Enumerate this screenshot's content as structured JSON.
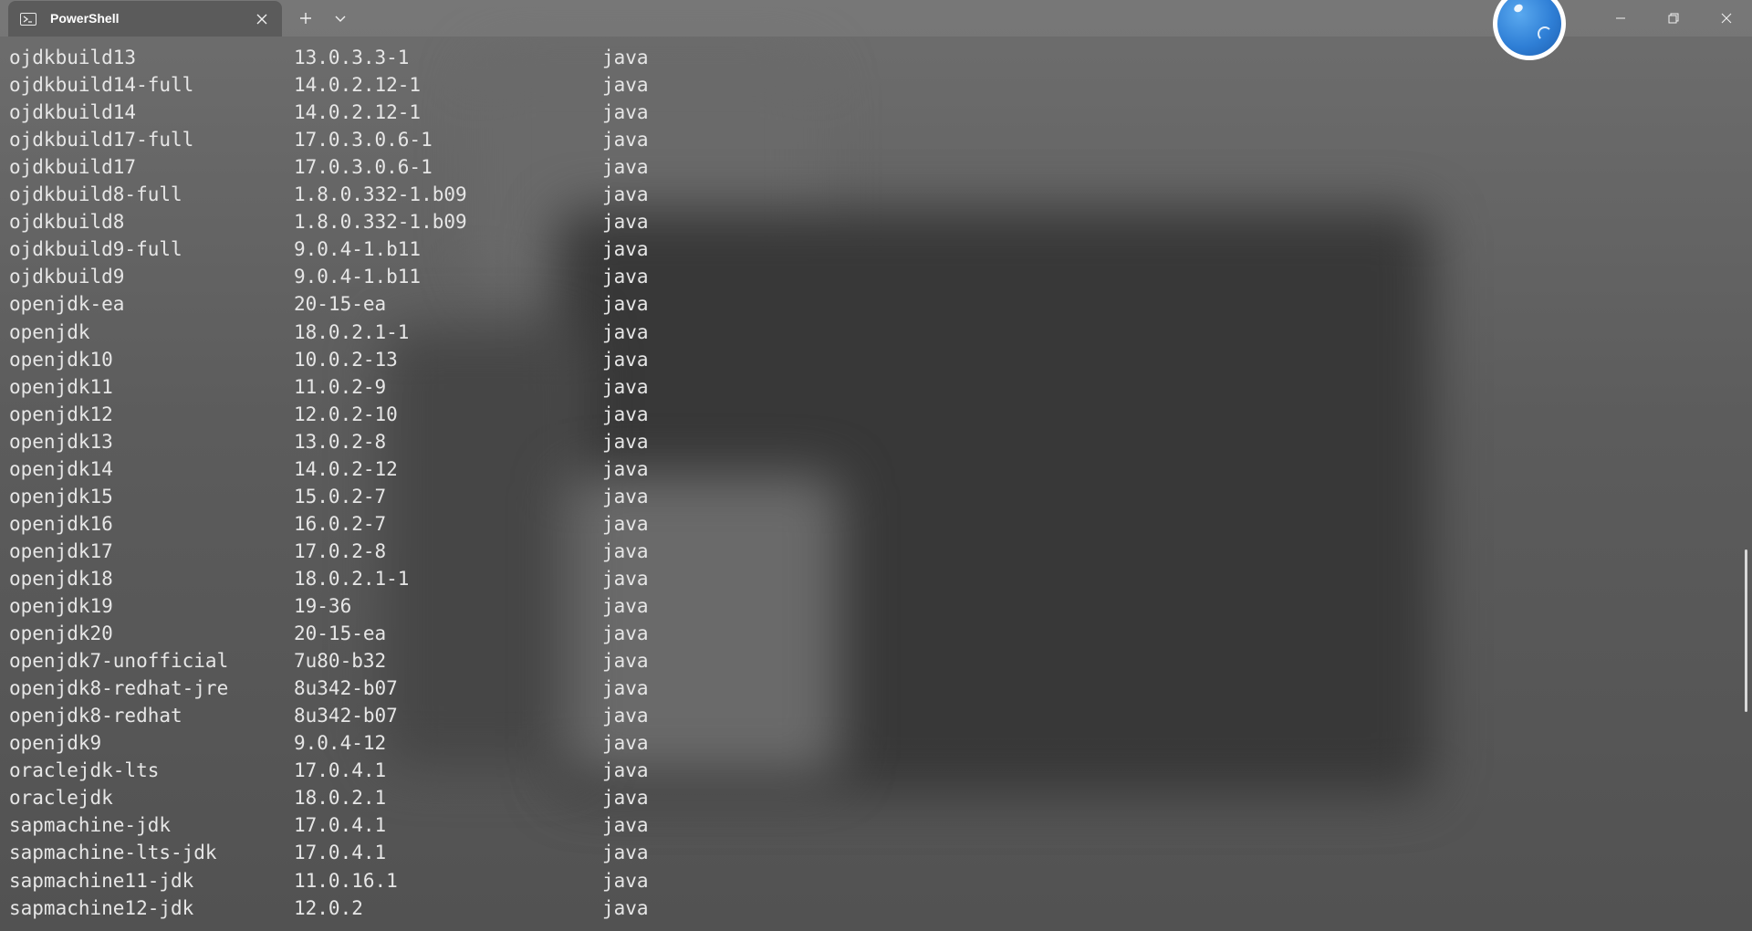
{
  "window": {
    "tab_title": "PowerShell",
    "tab_icon": "powershell-icon",
    "new_tab_icon": "plus-icon",
    "dropdown_icon": "chevron-down-icon",
    "controls": [
      "minimize-icon",
      "restore-icon",
      "close-icon"
    ]
  },
  "terminal": {
    "rows": [
      {
        "name": "ojdkbuild13",
        "version": "13.0.3.3-1",
        "source": "java"
      },
      {
        "name": "ojdkbuild14-full",
        "version": "14.0.2.12-1",
        "source": "java"
      },
      {
        "name": "ojdkbuild14",
        "version": "14.0.2.12-1",
        "source": "java"
      },
      {
        "name": "ojdkbuild17-full",
        "version": "17.0.3.0.6-1",
        "source": "java"
      },
      {
        "name": "ojdkbuild17",
        "version": "17.0.3.0.6-1",
        "source": "java"
      },
      {
        "name": "ojdkbuild8-full",
        "version": "1.8.0.332-1.b09",
        "source": "java"
      },
      {
        "name": "ojdkbuild8",
        "version": "1.8.0.332-1.b09",
        "source": "java"
      },
      {
        "name": "ojdkbuild9-full",
        "version": "9.0.4-1.b11",
        "source": "java"
      },
      {
        "name": "ojdkbuild9",
        "version": "9.0.4-1.b11",
        "source": "java"
      },
      {
        "name": "openjdk-ea",
        "version": "20-15-ea",
        "source": "java"
      },
      {
        "name": "openjdk",
        "version": "18.0.2.1-1",
        "source": "java"
      },
      {
        "name": "openjdk10",
        "version": "10.0.2-13",
        "source": "java"
      },
      {
        "name": "openjdk11",
        "version": "11.0.2-9",
        "source": "java"
      },
      {
        "name": "openjdk12",
        "version": "12.0.2-10",
        "source": "java"
      },
      {
        "name": "openjdk13",
        "version": "13.0.2-8",
        "source": "java"
      },
      {
        "name": "openjdk14",
        "version": "14.0.2-12",
        "source": "java"
      },
      {
        "name": "openjdk15",
        "version": "15.0.2-7",
        "source": "java"
      },
      {
        "name": "openjdk16",
        "version": "16.0.2-7",
        "source": "java"
      },
      {
        "name": "openjdk17",
        "version": "17.0.2-8",
        "source": "java"
      },
      {
        "name": "openjdk18",
        "version": "18.0.2.1-1",
        "source": "java"
      },
      {
        "name": "openjdk19",
        "version": "19-36",
        "source": "java"
      },
      {
        "name": "openjdk20",
        "version": "20-15-ea",
        "source": "java"
      },
      {
        "name": "openjdk7-unofficial",
        "version": "7u80-b32",
        "source": "java"
      },
      {
        "name": "openjdk8-redhat-jre",
        "version": "8u342-b07",
        "source": "java"
      },
      {
        "name": "openjdk8-redhat",
        "version": "8u342-b07",
        "source": "java"
      },
      {
        "name": "openjdk9",
        "version": "9.0.4-12",
        "source": "java"
      },
      {
        "name": "oraclejdk-lts",
        "version": "17.0.4.1",
        "source": "java"
      },
      {
        "name": "oraclejdk",
        "version": "18.0.2.1",
        "source": "java"
      },
      {
        "name": "sapmachine-jdk",
        "version": "17.0.4.1",
        "source": "java"
      },
      {
        "name": "sapmachine-lts-jdk",
        "version": "17.0.4.1",
        "source": "java"
      },
      {
        "name": "sapmachine11-jdk",
        "version": "11.0.16.1",
        "source": "java"
      },
      {
        "name": "sapmachine12-jdk",
        "version": "12.0.2",
        "source": "java"
      }
    ]
  }
}
